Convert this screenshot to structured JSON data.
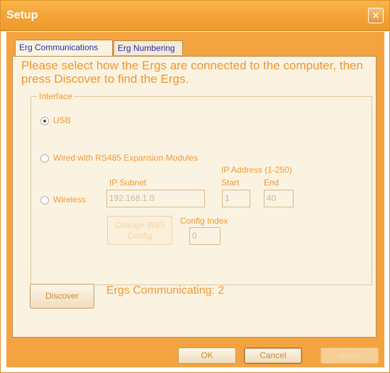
{
  "window": {
    "title": "Setup",
    "close_glyph": "×"
  },
  "tabs": [
    {
      "label": "Erg Communications",
      "active": true
    },
    {
      "label": "Erg Numbering",
      "active": false
    }
  ],
  "instructions": "Please select how the Ergs are connected to the computer, then press Discover to find the Ergs.",
  "interface": {
    "legend": "Interface",
    "options": [
      {
        "label": "USB",
        "checked": true
      },
      {
        "label": "Wired with RS485 Expansion Modules",
        "checked": false
      },
      {
        "label": "Wireless",
        "checked": false
      }
    ],
    "wireless": {
      "ip_subnet_label": "IP Subnet",
      "ip_subnet_value": "192.168.1.0",
      "ip_address_label": "IP Address (1-250)",
      "start_label": "Start",
      "start_value": "1",
      "end_label": "End",
      "end_value": "40",
      "change_wifi_label": "Change WIFI Config",
      "config_index_label": "Config Index",
      "config_index_value": "0"
    }
  },
  "discover": {
    "button_label": "Discover",
    "status_text": "Ergs Communicating: 2"
  },
  "footer": {
    "ok_label": "OK",
    "cancel_label": "Cancel",
    "apply_label": "Apply"
  },
  "colors": {
    "accent": "#f3a441",
    "label_text": "#ef9a37",
    "tab_text": "#2b2bb0"
  }
}
